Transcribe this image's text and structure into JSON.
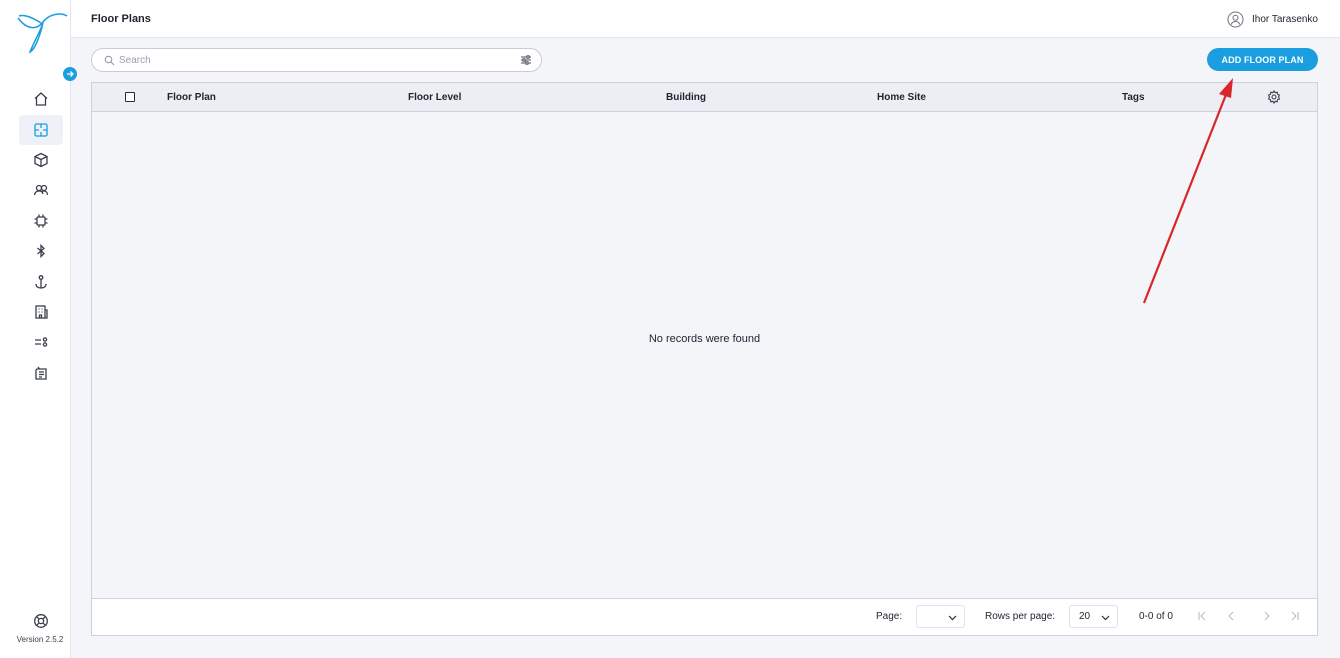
{
  "app": {
    "version": "Version 2.5.2"
  },
  "header": {
    "title": "Floor Plans",
    "user_name": "Ihor Tarasenko"
  },
  "sidebar": {
    "items": [
      {
        "icon": "home-icon"
      },
      {
        "icon": "floor-plan-icon",
        "active": true
      },
      {
        "icon": "cube-icon"
      },
      {
        "icon": "users-icon"
      },
      {
        "icon": "chip-icon"
      },
      {
        "icon": "bluetooth-icon"
      },
      {
        "icon": "anchor-icon"
      },
      {
        "icon": "building-icon"
      },
      {
        "icon": "rules-icon"
      },
      {
        "icon": "reports-icon"
      }
    ]
  },
  "toolbar": {
    "search_placeholder": "Search",
    "search_value": "",
    "add_label": "ADD FLOOR PLAN"
  },
  "table": {
    "columns": [
      "Floor Plan",
      "Floor Level",
      "Building",
      "Home Site",
      "Tags"
    ],
    "rows": [],
    "empty_message": "No records were found"
  },
  "pagination": {
    "page_label": "Page:",
    "page_value": "",
    "rows_per_page_label": "Rows per page:",
    "rows_per_page_value": "20",
    "range_text": "0-0 of 0"
  },
  "colors": {
    "accent": "#1a9ee0",
    "annotation_arrow": "#d9262b"
  }
}
